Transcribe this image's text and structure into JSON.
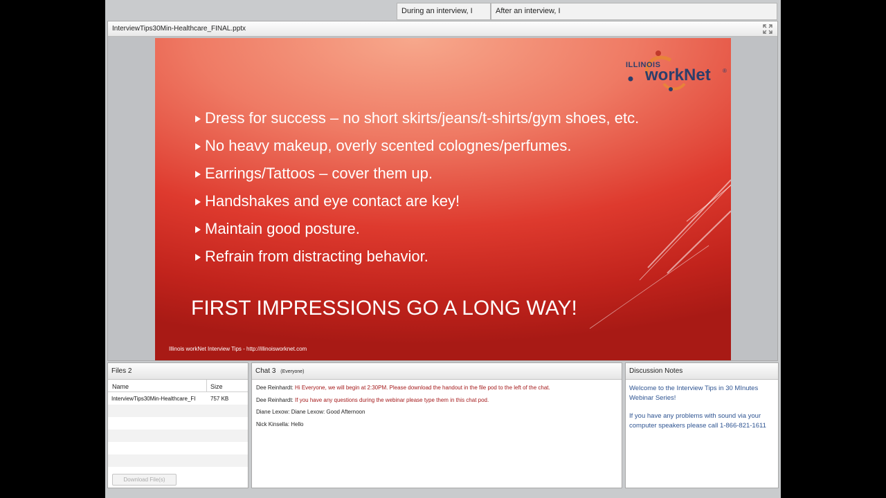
{
  "top_tabs": [
    "During an interview, I",
    "After an interview, I"
  ],
  "share_pod": {
    "title": "InterviewTips30Min-Healthcare_FINAL.pptx",
    "fullscreen_icon": "fullscreen-icon"
  },
  "slide": {
    "logo": {
      "state": "ILLINOIS",
      "brand": "workNet",
      "mark": "®"
    },
    "bullets": [
      "Dress for success – no short skirts/jeans/t-shirts/gym shoes, etc.",
      "No heavy makeup, overly scented colognes/perfumes.",
      "Earrings/Tattoos – cover them up.",
      "Handshakes and eye contact are key!",
      "Maintain good posture.",
      "Refrain from distracting behavior."
    ],
    "headline": "FIRST IMPRESSIONS GO A LONG WAY!",
    "footer": "Illinois workNet Interview Tips - http://illinoisworknet.com"
  },
  "files_pod": {
    "title": "Files 2",
    "columns": [
      "Name",
      "Size"
    ],
    "rows": [
      {
        "name": "InterviewTips30Min-Healthcare_FI",
        "size": "757 KB"
      },
      {
        "name": "",
        "size": ""
      },
      {
        "name": "",
        "size": ""
      },
      {
        "name": "",
        "size": ""
      },
      {
        "name": "",
        "size": ""
      },
      {
        "name": "",
        "size": ""
      }
    ],
    "download_label": "Download File(s)"
  },
  "chat_pod": {
    "title": "Chat 3",
    "audience": "(Everyone)",
    "messages": [
      {
        "sender": "Dee  Reinhardt:",
        "text": "Hi Everyone, we will begin at 2:30PM. Please download the handout in the file pod to the left of the chat.",
        "color": "#a4191a"
      },
      {
        "sender": "Dee  Reinhardt:",
        "text": "If you have any questions during the webinar please type them in this chat pod.",
        "color": "#a4191a"
      },
      {
        "sender": "Diane Lexow:",
        "text": "Diane Lexow: Good Afternoon",
        "color": "#222222"
      },
      {
        "sender": "Nick Kinsella:",
        "text": "Hello",
        "color": "#222222"
      }
    ]
  },
  "notes_pod": {
    "title": "Discussion Notes",
    "paragraphs": [
      "Welcome to the Interview Tips in 30 MInutes Webinar Series!",
      "If you have any problems with sound via your computer speakers please call 1-866-821-1611"
    ]
  },
  "colors": {
    "slide_red": "#d8352a",
    "slide_peach": "#f7a88c",
    "chat_red": "#a4191a",
    "notes_blue": "#2d5391",
    "logo_navy": "#2c3e6b",
    "logo_orange": "#e8833a"
  }
}
